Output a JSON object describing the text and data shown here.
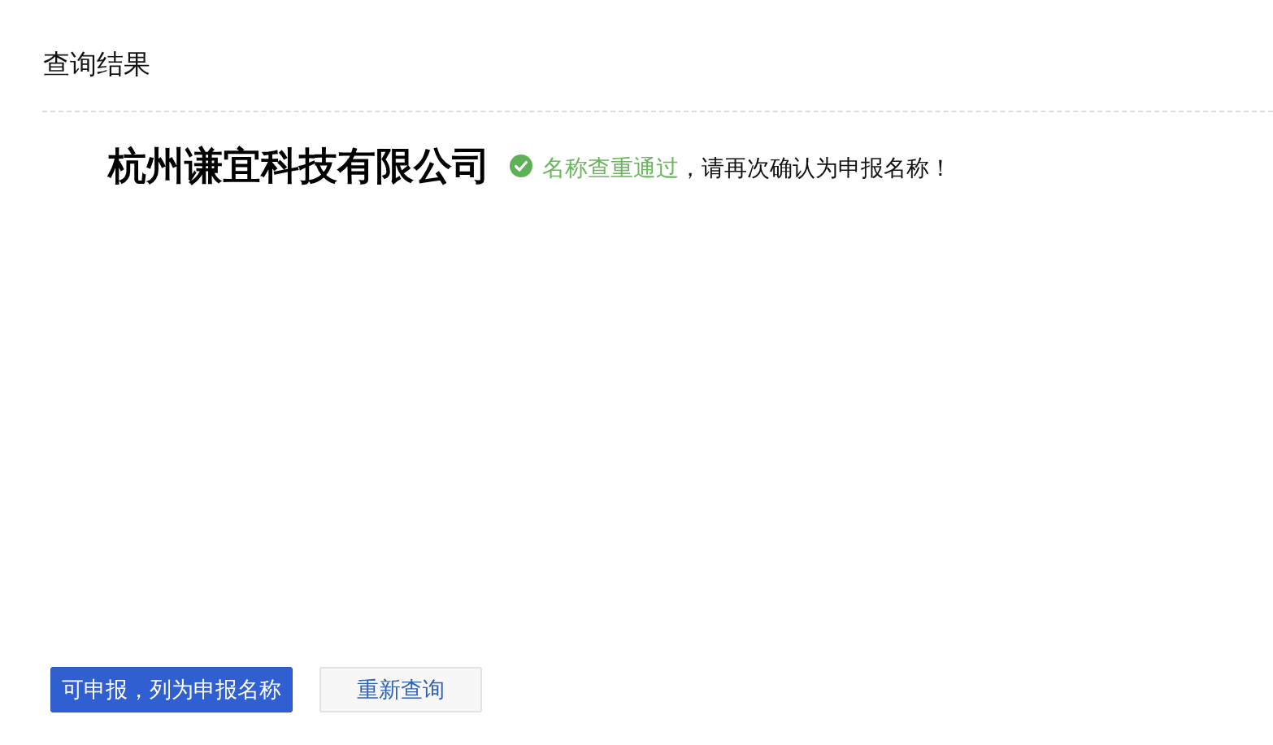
{
  "heading": "查询结果",
  "result": {
    "company_name": "杭州谦宜科技有限公司",
    "status": "名称查重通过",
    "message": "，请再次确认为申报名称！"
  },
  "buttons": [
    {
      "label": "可申报，列为申报名称",
      "kind": "primary"
    },
    {
      "label": "重新查询",
      "kind": "secondary"
    }
  ]
}
